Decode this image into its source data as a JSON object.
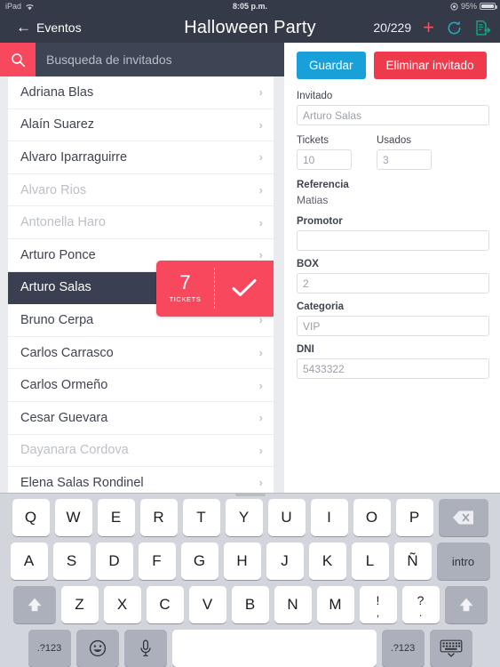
{
  "statusbar": {
    "device": "iPad",
    "wifi_icon": "wifi-icon",
    "time": "8:05 p.m.",
    "battery_percent": "95%",
    "location_icon": "location-icon"
  },
  "navbar": {
    "back_label": "Eventos",
    "back_icon": "back-arrow-icon",
    "title": "Halloween Party",
    "counter": "20/229",
    "add_icon": "plus-icon",
    "refresh_icon": "refresh-icon",
    "export_icon": "export-document-icon",
    "accent_add": "#f05361",
    "accent_refresh": "#1fa8c9",
    "accent_export": "#12a37a"
  },
  "search": {
    "icon": "search-icon",
    "placeholder": "Busqueda de invitados",
    "value": "",
    "button_color": "#f8485e"
  },
  "guest_list": {
    "items": [
      {
        "name": "Adriana Blas",
        "state": "normal"
      },
      {
        "name": "Alaín Suarez",
        "state": "normal"
      },
      {
        "name": "Alvaro Iparraguirre",
        "state": "normal"
      },
      {
        "name": "Alvaro Rios",
        "state": "dim"
      },
      {
        "name": "Antonella Haro",
        "state": "dim"
      },
      {
        "name": "Arturo Ponce",
        "state": "normal"
      },
      {
        "name": "Arturo Salas",
        "state": "selected"
      },
      {
        "name": "Bruno Cerpa",
        "state": "normal"
      },
      {
        "name": "Carlos Carrasco",
        "state": "normal"
      },
      {
        "name": "Carlos Ormeño",
        "state": "normal"
      },
      {
        "name": "Cesar Guevara",
        "state": "normal"
      },
      {
        "name": "Dayanara Cordova",
        "state": "dim"
      },
      {
        "name": "Elena Salas Rondinel",
        "state": "normal"
      }
    ],
    "chevron_icon": "chevron-right-icon"
  },
  "swipe_action": {
    "count": "7",
    "label": "TICKETS",
    "check_icon": "check-icon",
    "background": "#f8485e"
  },
  "form": {
    "save_label": "Guardar",
    "delete_label": "Eliminar invitado",
    "save_color": "#19a0d8",
    "delete_color": "#ee3a4a",
    "fields": {
      "invitado_label": "Invitado",
      "invitado_value": "Arturo Salas",
      "tickets_label": "Tickets",
      "tickets_value": "10",
      "usados_label": "Usados",
      "usados_value": "3",
      "referencia_label": "Referencia",
      "referencia_value": "Matias",
      "promotor_label": "Promotor",
      "promotor_value": "",
      "box_label": "BOX",
      "box_value": "2",
      "categoria_label": "Categoria",
      "categoria_value": "VIP",
      "dni_label": "DNI",
      "dni_value": "5433322"
    }
  },
  "keyboard": {
    "row1": [
      "Q",
      "W",
      "E",
      "R",
      "T",
      "Y",
      "U",
      "I",
      "O",
      "P"
    ],
    "row2": [
      "A",
      "S",
      "D",
      "F",
      "G",
      "H",
      "J",
      "K",
      "L",
      "Ñ"
    ],
    "row3": [
      "Z",
      "X",
      "C",
      "V",
      "B",
      "N",
      "M"
    ],
    "row3_dual": [
      {
        "top": "!",
        "bot": ","
      },
      {
        "top": "?",
        "bot": "."
      }
    ],
    "backspace_icon": "backspace-icon",
    "enter_label": "intro",
    "shift_icon": "shift-icon",
    "numeric_label": ".?123",
    "emoji_icon": "emoji-icon",
    "mic_icon": "microphone-icon",
    "space_label": "",
    "hide_keyboard_icon": "hide-keyboard-icon"
  }
}
